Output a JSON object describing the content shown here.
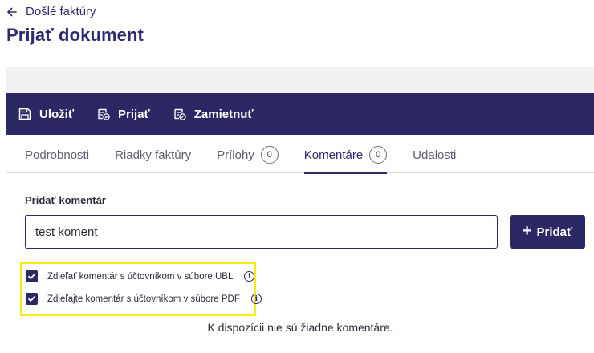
{
  "header": {
    "back_label": "Došlé faktúry",
    "title": "Prijať dokument"
  },
  "toolbar": {
    "save_label": "Uložiť",
    "accept_label": "Prijať",
    "reject_label": "Zamietnuť"
  },
  "tabs": [
    {
      "label": "Podrobnosti",
      "active": false
    },
    {
      "label": "Riadky faktúry",
      "active": false
    },
    {
      "label": "Prílohy",
      "count": "0",
      "active": false
    },
    {
      "label": "Komentáre",
      "count": "0",
      "active": true
    },
    {
      "label": "Udalosti",
      "active": false
    }
  ],
  "comments": {
    "label": "Pridať komentár",
    "input_value": "test koment",
    "add_button_label": "Pridať",
    "options": [
      {
        "label": "Zdieľať komentár s účtovníkom v súbore UBL",
        "checked": true,
        "icon": "info-icon"
      },
      {
        "label": "Zdieľajte komentár s účtovníkom v súbore PDF",
        "checked": true,
        "icon": "info-icon"
      }
    ],
    "empty_message": "K dispozícii nie sú žiadne komentáre."
  },
  "colors": {
    "brand": "#2c2866",
    "highlight": "#f7ec14",
    "background": "#f1f1f3"
  }
}
